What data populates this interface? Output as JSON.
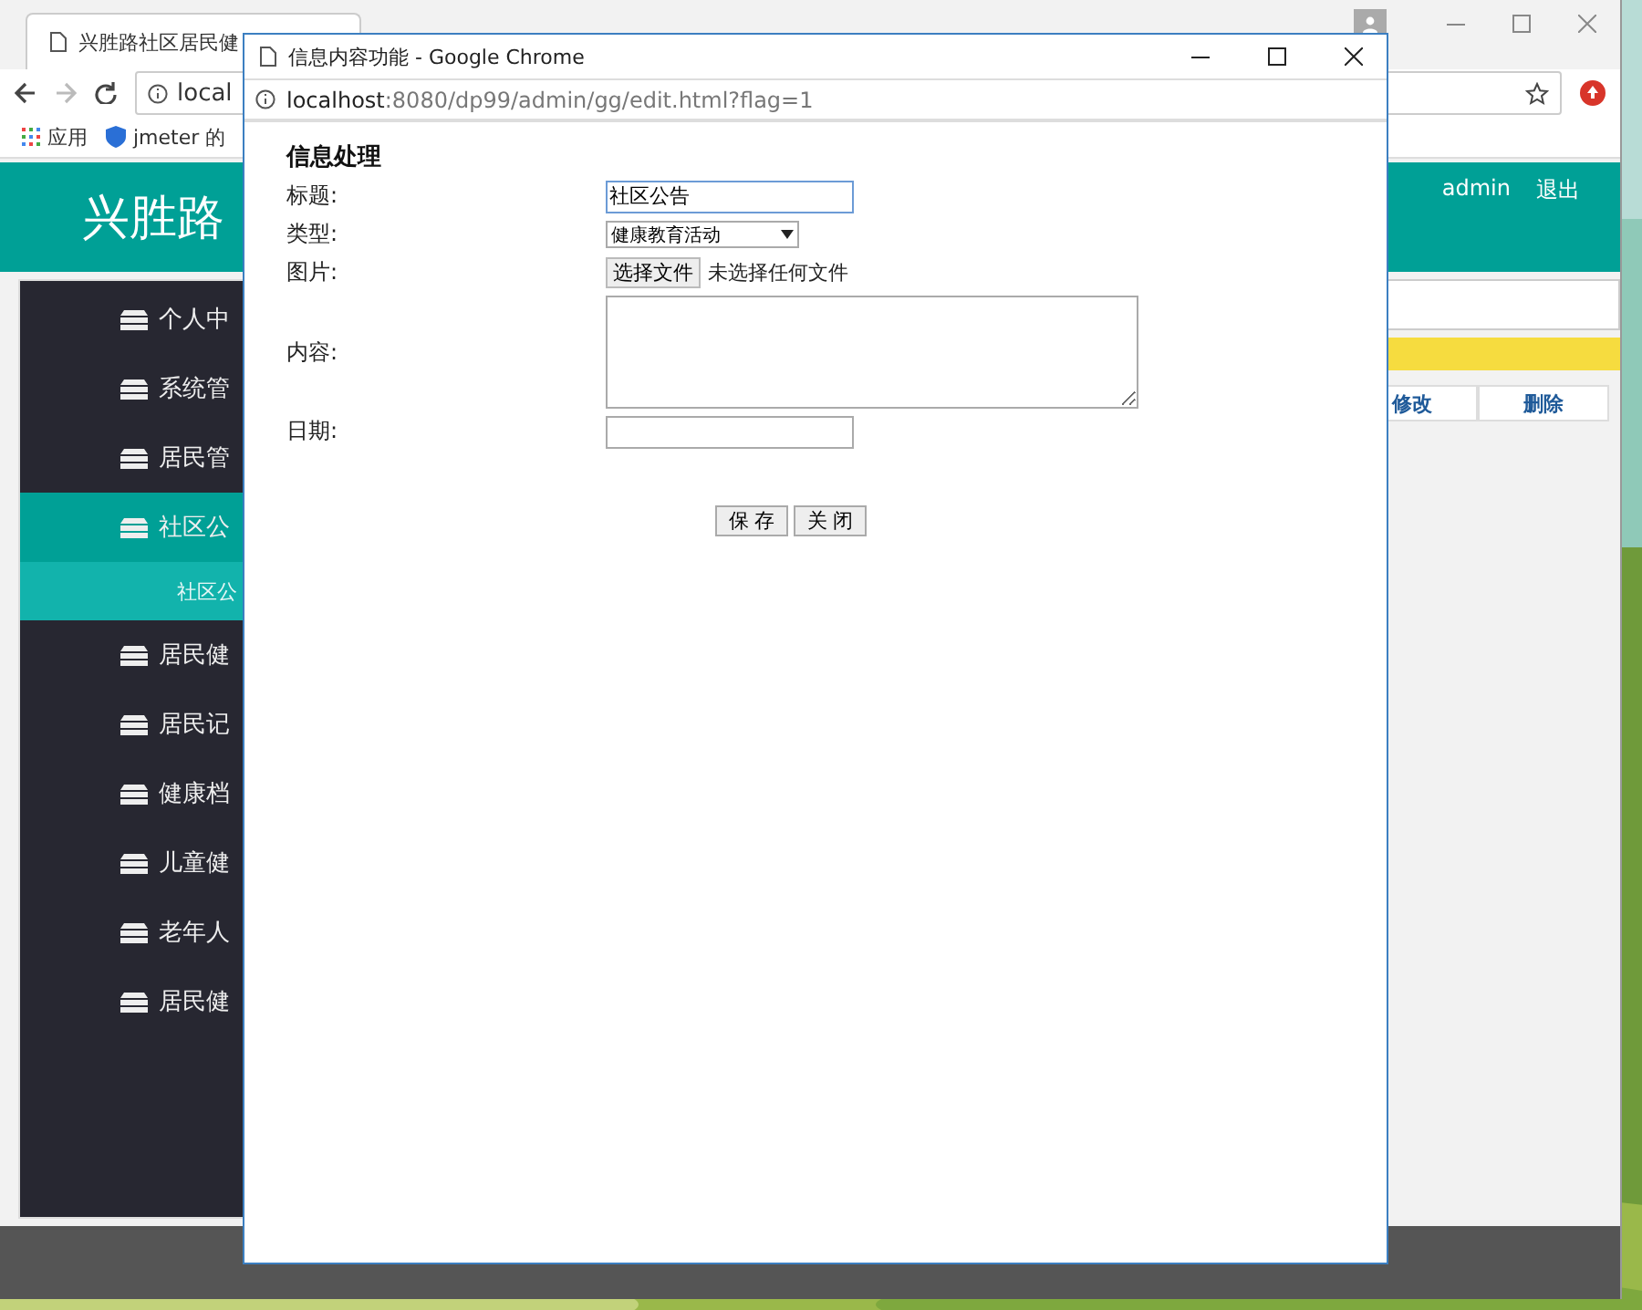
{
  "back_window": {
    "tab_title": "兴胜路社区居民健",
    "address": "local",
    "bookmarks": [
      {
        "kind": "apps",
        "label": "应用"
      },
      {
        "kind": "shield",
        "label": "jmeter 的"
      }
    ],
    "header": {
      "title": "兴胜路",
      "user": "admin",
      "logout": "退出"
    },
    "sidebar": [
      {
        "label": "个人中",
        "selected": false
      },
      {
        "label": "系统管",
        "selected": false
      },
      {
        "label": "居民管",
        "selected": false
      },
      {
        "label": "社区公",
        "selected": true,
        "children": [
          {
            "label": "社区公"
          }
        ]
      },
      {
        "label": "居民健",
        "selected": false
      },
      {
        "label": "居民记",
        "selected": false
      },
      {
        "label": "健康档",
        "selected": false
      },
      {
        "label": "儿童健",
        "selected": false
      },
      {
        "label": "老年人",
        "selected": false
      },
      {
        "label": "居民健",
        "selected": false
      }
    ],
    "row_actions": [
      "修改",
      "删除"
    ]
  },
  "popup": {
    "title": "信息内容功能 - Google Chrome",
    "url_host": "localhost",
    "url_path": ":8080/dp99/admin/gg/edit.html?flag=1",
    "heading": "信息处理",
    "fields": [
      {
        "kind": "text",
        "label": "标题:",
        "value": "社区公告",
        "focused": true
      },
      {
        "kind": "select",
        "label": "类型:",
        "value": "健康教育活动"
      },
      {
        "kind": "file",
        "label": "图片:",
        "button": "选择文件",
        "status": "未选择任何文件"
      },
      {
        "kind": "textarea",
        "label": "内容:"
      },
      {
        "kind": "text",
        "label": "日期:",
        "focused": false
      }
    ],
    "buttons": [
      "保 存",
      "关 闭"
    ]
  }
}
